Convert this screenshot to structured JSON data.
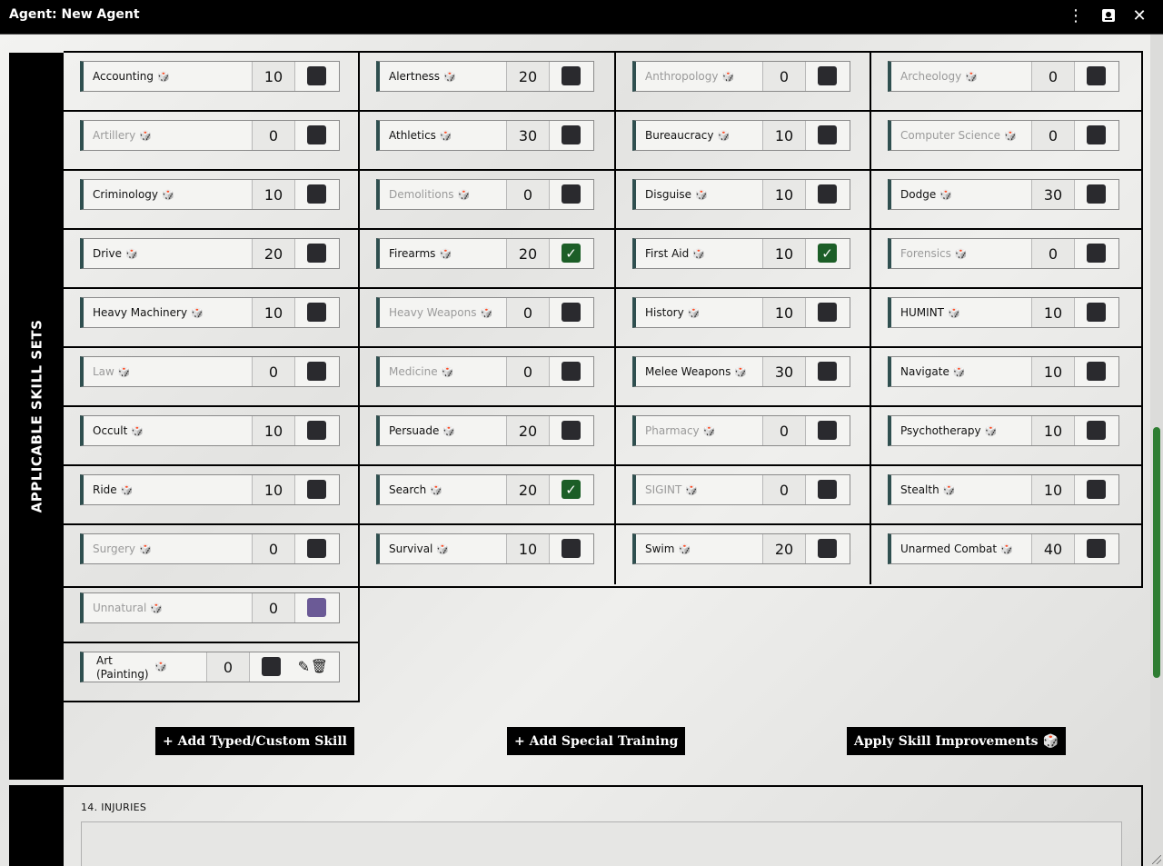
{
  "window": {
    "title": "Agent: New Agent"
  },
  "sidebar": {
    "label": "APPLICABLE SKILL SETS"
  },
  "skills": [
    {
      "name": "Accounting",
      "value": "10",
      "dim": false,
      "checked": false
    },
    {
      "name": "Alertness",
      "value": "20",
      "dim": false,
      "checked": false
    },
    {
      "name": "Anthropology",
      "value": "0",
      "dim": true,
      "checked": false
    },
    {
      "name": "Archeology",
      "value": "0",
      "dim": true,
      "checked": false
    },
    {
      "name": "Artillery",
      "value": "0",
      "dim": true,
      "checked": false
    },
    {
      "name": "Athletics",
      "value": "30",
      "dim": false,
      "checked": false
    },
    {
      "name": "Bureaucracy",
      "value": "10",
      "dim": false,
      "checked": false
    },
    {
      "name": "Computer Science",
      "value": "0",
      "dim": true,
      "checked": false
    },
    {
      "name": "Criminology",
      "value": "10",
      "dim": false,
      "checked": false
    },
    {
      "name": "Demolitions",
      "value": "0",
      "dim": true,
      "checked": false
    },
    {
      "name": "Disguise",
      "value": "10",
      "dim": false,
      "checked": false
    },
    {
      "name": "Dodge",
      "value": "30",
      "dim": false,
      "checked": false
    },
    {
      "name": "Drive",
      "value": "20",
      "dim": false,
      "checked": false
    },
    {
      "name": "Firearms",
      "value": "20",
      "dim": false,
      "checked": true
    },
    {
      "name": "First Aid",
      "value": "10",
      "dim": false,
      "checked": true
    },
    {
      "name": "Forensics",
      "value": "0",
      "dim": true,
      "checked": false
    },
    {
      "name": "Heavy Machinery",
      "value": "10",
      "dim": false,
      "checked": false
    },
    {
      "name": "Heavy Weapons",
      "value": "0",
      "dim": true,
      "checked": false
    },
    {
      "name": "History",
      "value": "10",
      "dim": false,
      "checked": false
    },
    {
      "name": "HUMINT",
      "value": "10",
      "dim": false,
      "checked": false
    },
    {
      "name": "Law",
      "value": "0",
      "dim": true,
      "checked": false
    },
    {
      "name": "Medicine",
      "value": "0",
      "dim": true,
      "checked": false
    },
    {
      "name": "Melee Weapons",
      "value": "30",
      "dim": false,
      "checked": false
    },
    {
      "name": "Navigate",
      "value": "10",
      "dim": false,
      "checked": false
    },
    {
      "name": "Occult",
      "value": "10",
      "dim": false,
      "checked": false
    },
    {
      "name": "Persuade",
      "value": "20",
      "dim": false,
      "checked": false
    },
    {
      "name": "Pharmacy",
      "value": "0",
      "dim": true,
      "checked": false
    },
    {
      "name": "Psychotherapy",
      "value": "10",
      "dim": false,
      "checked": false
    },
    {
      "name": "Ride",
      "value": "10",
      "dim": false,
      "checked": false
    },
    {
      "name": "Search",
      "value": "20",
      "dim": false,
      "checked": true
    },
    {
      "name": "SIGINT",
      "value": "0",
      "dim": true,
      "checked": false
    },
    {
      "name": "Stealth",
      "value": "10",
      "dim": false,
      "checked": false
    },
    {
      "name": "Surgery",
      "value": "0",
      "dim": true,
      "checked": false
    },
    {
      "name": "Survival",
      "value": "10",
      "dim": false,
      "checked": false
    },
    {
      "name": "Swim",
      "value": "20",
      "dim": false,
      "checked": false
    },
    {
      "name": "Unarmed Combat",
      "value": "40",
      "dim": false,
      "checked": false
    }
  ],
  "unnatural": {
    "name": "Unnatural",
    "value": "0"
  },
  "custom_skill": {
    "name_line1": "Art",
    "name_line2": "(Painting)",
    "value": "0"
  },
  "actions": {
    "add_typed": "+ Add Typed/Custom Skill",
    "add_training": "+ Add Special Training",
    "apply_improvements": "Apply Skill Improvements"
  },
  "injuries": {
    "label": "14. INJURIES",
    "value": ""
  },
  "icons": {
    "dice": "dice-icon",
    "check": "check-icon"
  },
  "colors": {
    "check_on": "#1c5e27",
    "unnatural_check": "#6b5a96",
    "scroll_thumb": "#2e7d32"
  }
}
